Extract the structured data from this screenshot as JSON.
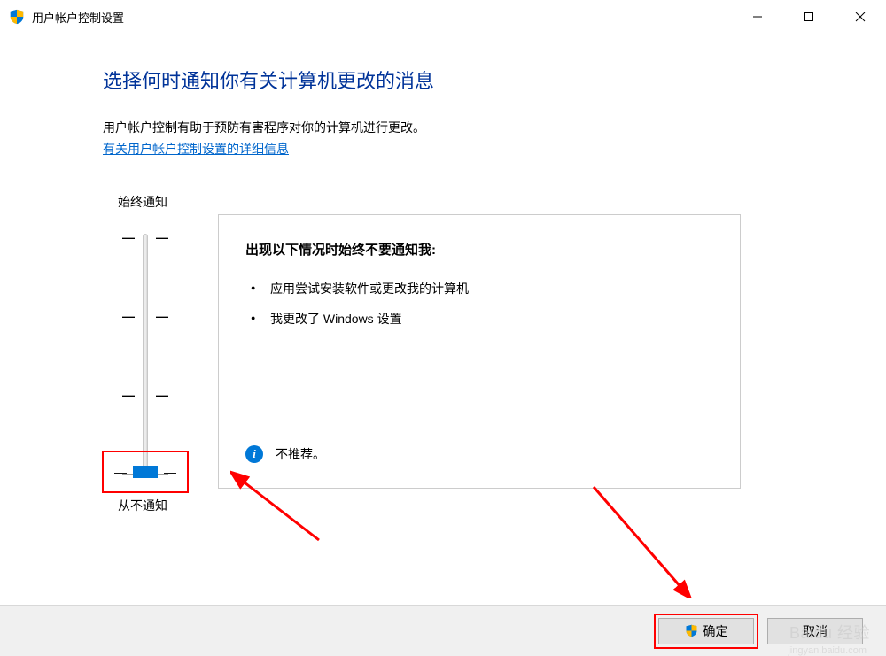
{
  "window": {
    "title": "用户帐户控制设置"
  },
  "content": {
    "heading": "选择何时通知你有关计算机更改的消息",
    "description": "用户帐户控制有助于预防有害程序对你的计算机进行更改。",
    "link": "有关用户帐户控制设置的详细信息"
  },
  "slider": {
    "top_label": "始终通知",
    "bottom_label": "从不通知",
    "tick_dash": "—",
    "position": 3
  },
  "details": {
    "title": "出现以下情况时始终不要通知我:",
    "items": [
      "应用尝试安装软件或更改我的计算机",
      "我更改了 Windows 设置"
    ],
    "recommendation": "不推荐。"
  },
  "footer": {
    "ok_label": "确定",
    "cancel_label": "取消"
  },
  "watermark": {
    "main": "Baidu 经验",
    "sub": "jingyan.baidu.com"
  }
}
